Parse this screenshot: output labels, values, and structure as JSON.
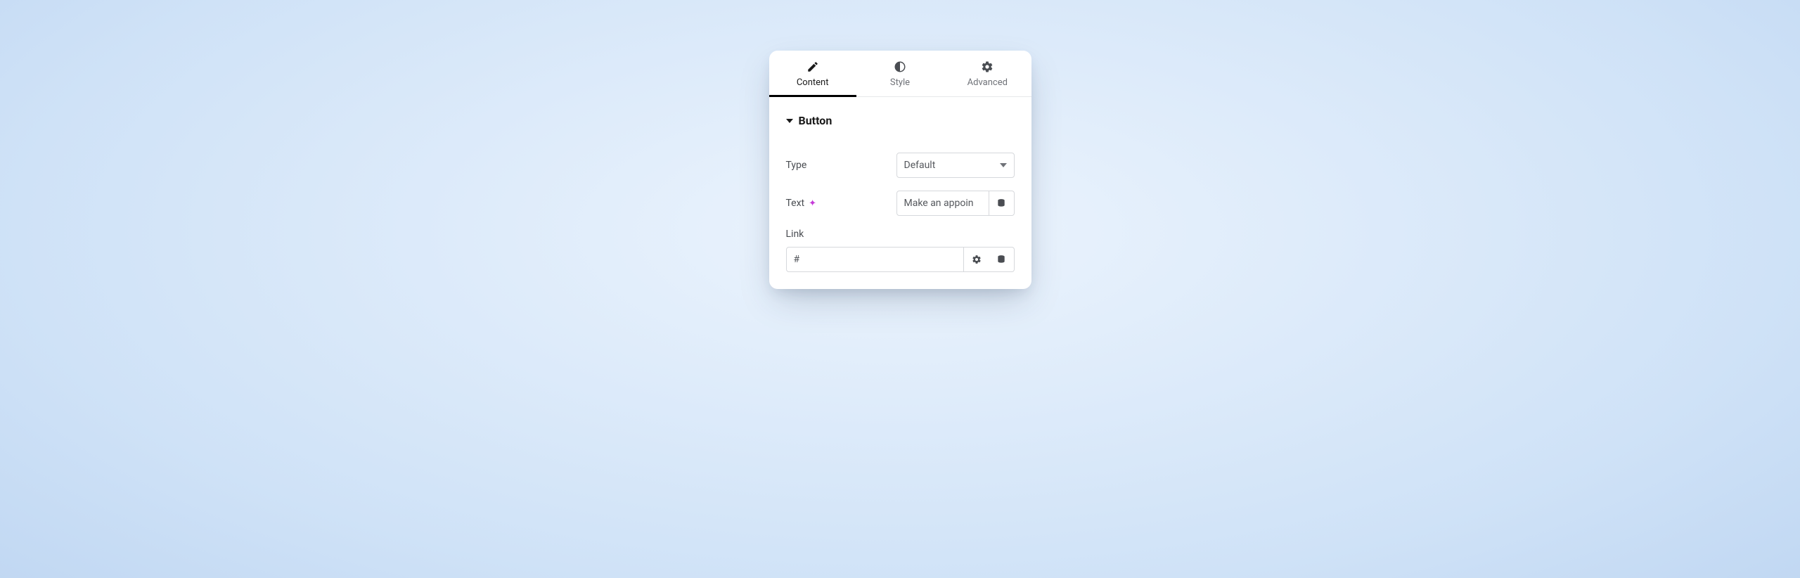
{
  "tabs": {
    "content": "Content",
    "style": "Style",
    "advanced": "Advanced"
  },
  "section": {
    "title": "Button"
  },
  "fields": {
    "type": {
      "label": "Type",
      "value": "Default"
    },
    "text": {
      "label": "Text",
      "value": "Make an appoin"
    },
    "link": {
      "label": "Link",
      "value": "#"
    }
  }
}
